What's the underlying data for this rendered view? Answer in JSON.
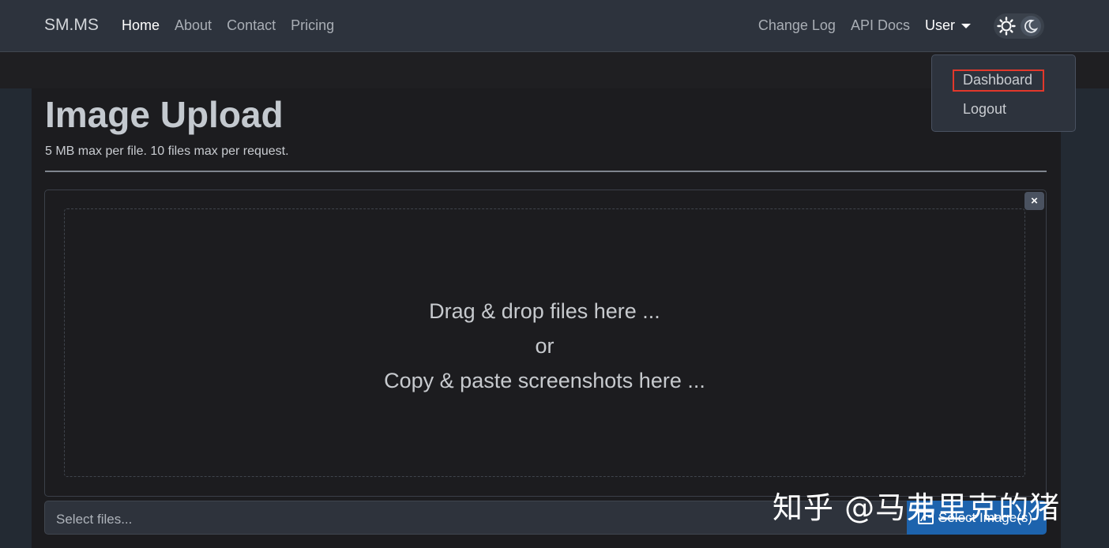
{
  "nav": {
    "brand": "SM.MS",
    "left_items": [
      "Home",
      "About",
      "Contact",
      "Pricing"
    ],
    "right_items": [
      "Change Log",
      "API Docs"
    ],
    "user_label": "User"
  },
  "dropdown": {
    "items": [
      "Dashboard",
      "Logout"
    ]
  },
  "page": {
    "title": "Image Upload",
    "subtitle": "5 MB max per file. 10 files max per request."
  },
  "dropzone": {
    "line1": "Drag & drop files here ...",
    "line2": "or",
    "line3": "Copy & paste screenshots here ...",
    "close_label": "×"
  },
  "file_input": {
    "placeholder": "Select files...",
    "button_label": "Select Image(s)"
  },
  "watermark": "知乎 @马弗里克的猪",
  "colors": {
    "navbar": "#2d333d",
    "background": "#1b1c20",
    "primary": "#1d63ad",
    "highlight": "#e2382b"
  }
}
